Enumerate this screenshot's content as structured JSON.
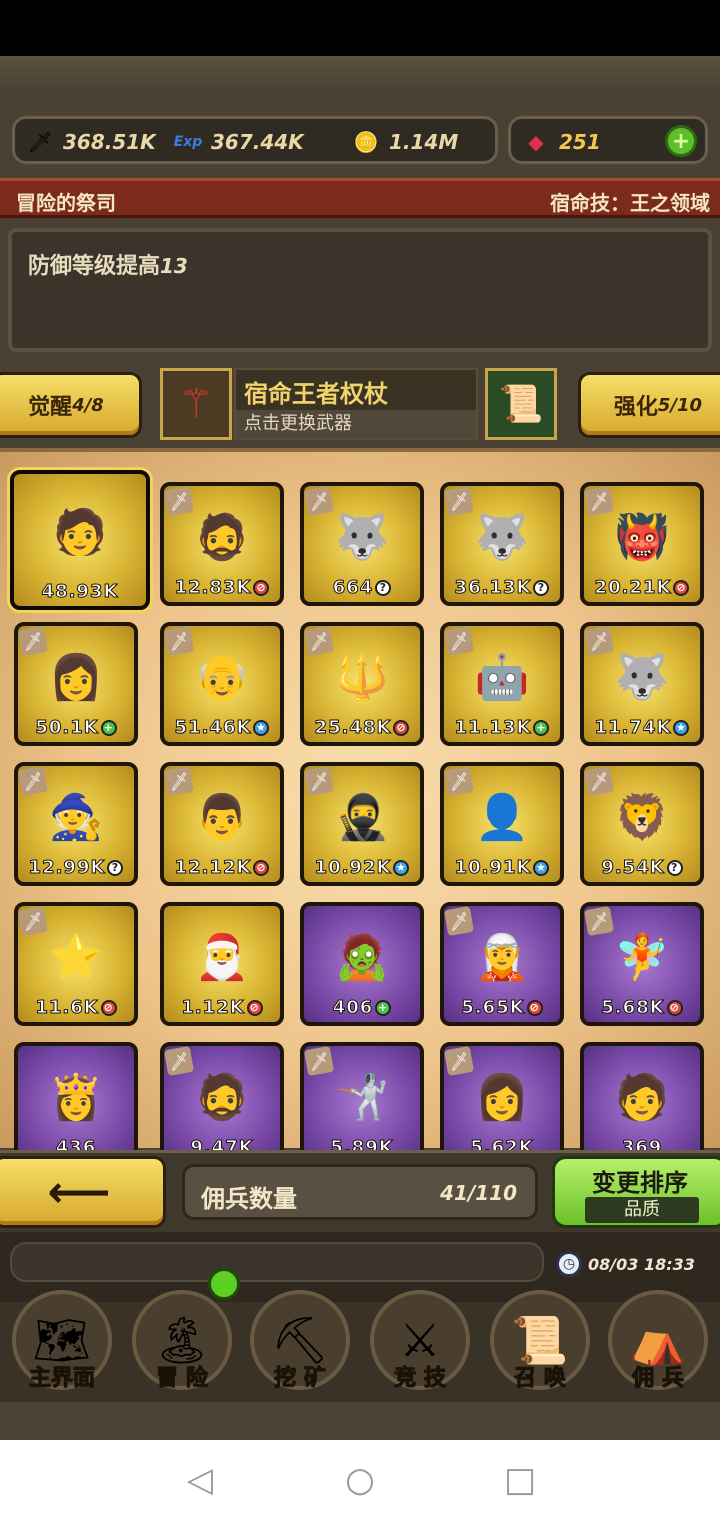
{
  "resources": {
    "attack": {
      "icon": "sword-icon",
      "value": "368.51K"
    },
    "exp": {
      "icon": "exp-icon",
      "value": "367.44K"
    },
    "gold": {
      "icon": "gold-icon",
      "value": "1.14M"
    },
    "gems": {
      "icon": "gem-icon",
      "value": "251"
    },
    "add_icon": "+"
  },
  "hero": {
    "name": "冒险的祭司",
    "destiny_skill": "宿命技：王之领域",
    "description": "防御等级提高",
    "description_value": "13"
  },
  "weapon": {
    "awaken_label": "觉醒",
    "awaken_value": "4/8",
    "name": "宿命王者权杖",
    "hint": "点击更换武器",
    "enhance_label": "强化",
    "enhance_value": "5/10"
  },
  "mercenaries": [
    {
      "value": "48.93K",
      "rarity": "gold",
      "cls": "",
      "face": "🧑",
      "selected": true,
      "equipped": false
    },
    {
      "value": "12.83K",
      "rarity": "gold",
      "cls": "red",
      "face": "🧔",
      "equipped": true
    },
    {
      "value": "664",
      "rarity": "gold",
      "cls": "white",
      "face": "🐺",
      "equipped": true
    },
    {
      "value": "36.13K",
      "rarity": "gold",
      "cls": "white",
      "face": "🐺",
      "equipped": true
    },
    {
      "value": "20.21K",
      "rarity": "gold",
      "cls": "red",
      "face": "👹",
      "equipped": true
    },
    {
      "value": "50.1K",
      "rarity": "gold",
      "cls": "green",
      "face": "👩",
      "equipped": true
    },
    {
      "value": "51.46K",
      "rarity": "gold",
      "cls": "blue",
      "face": "👴",
      "equipped": true
    },
    {
      "value": "25.48K",
      "rarity": "gold",
      "cls": "red",
      "face": "🔱",
      "equipped": true
    },
    {
      "value": "11.13K",
      "rarity": "gold",
      "cls": "green",
      "face": "🤖",
      "equipped": true
    },
    {
      "value": "11.74K",
      "rarity": "gold",
      "cls": "blue",
      "face": "🐺",
      "equipped": true
    },
    {
      "value": "12.99K",
      "rarity": "gold",
      "cls": "white",
      "face": "🧙",
      "equipped": true
    },
    {
      "value": "12.12K",
      "rarity": "gold",
      "cls": "red",
      "face": "👨",
      "equipped": true
    },
    {
      "value": "10.92K",
      "rarity": "gold",
      "cls": "blue",
      "face": "🥷",
      "equipped": true
    },
    {
      "value": "10.91K",
      "rarity": "gold",
      "cls": "blue",
      "face": "👤",
      "equipped": true
    },
    {
      "value": "9.54K",
      "rarity": "gold",
      "cls": "white",
      "face": "🦁",
      "equipped": true
    },
    {
      "value": "11.6K",
      "rarity": "gold",
      "cls": "red",
      "face": "⭐",
      "equipped": true
    },
    {
      "value": "1.12K",
      "rarity": "gold",
      "cls": "red",
      "face": "🎅",
      "equipped": false
    },
    {
      "value": "406",
      "rarity": "purple",
      "cls": "green",
      "face": "🧟",
      "equipped": false
    },
    {
      "value": "5.65K",
      "rarity": "purple",
      "cls": "red",
      "face": "🧝",
      "equipped": true
    },
    {
      "value": "5.68K",
      "rarity": "purple",
      "cls": "red",
      "face": "🧚",
      "equipped": true
    }
  ],
  "mercenaries_row5": [
    {
      "value": "436",
      "rarity": "purple",
      "face": "👸",
      "equipped": false
    },
    {
      "value": "9.47K",
      "rarity": "purple",
      "face": "🧔",
      "equipped": true
    },
    {
      "value": "5.89K",
      "rarity": "purple",
      "face": "🤺",
      "equipped": true
    },
    {
      "value": "5.62K",
      "rarity": "purple",
      "face": "👩",
      "equipped": true
    },
    {
      "value": "369",
      "rarity": "purple",
      "face": "🧑",
      "equipped": false
    }
  ],
  "footer": {
    "back_icon": "⟵",
    "count_label": "佣兵数量",
    "count_value": "41/110",
    "sort_label": "变更排序",
    "sort_value": "品质",
    "datetime": "08/03 18:33"
  },
  "nav": [
    {
      "label": "主界面",
      "icon": "map-icon"
    },
    {
      "label": "冒 险",
      "icon": "island-icon"
    },
    {
      "label": "挖 矿",
      "icon": "pickaxe-icon"
    },
    {
      "label": "竞 技",
      "icon": "crossed-swords-icon"
    },
    {
      "label": "召 唤",
      "icon": "scroll-icon"
    },
    {
      "label": "佣 兵",
      "icon": "tent-icon"
    }
  ]
}
